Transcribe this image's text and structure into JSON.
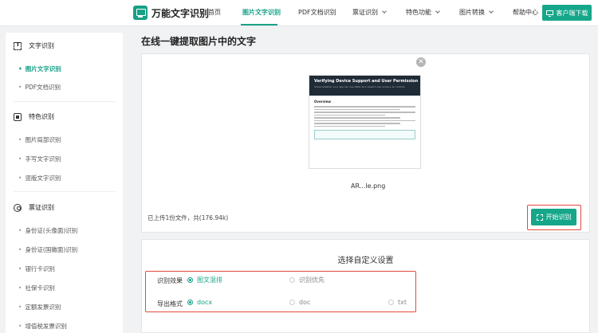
{
  "header": {
    "logo_text": "万能文字识别",
    "nav": [
      {
        "label": "首页"
      },
      {
        "label": "图片文字识别",
        "active": true
      },
      {
        "label": "PDF文档识别"
      },
      {
        "label": "票证识别",
        "dropdown": true
      },
      {
        "label": "特色功能",
        "dropdown": true
      },
      {
        "label": "图片转换",
        "dropdown": true
      },
      {
        "label": "帮助中心"
      }
    ],
    "client_button": "客户端下载"
  },
  "sidebar": {
    "groups": [
      {
        "title": "文字识别",
        "icon": "text-scan-icon",
        "items": [
          {
            "label": "图片文字识别",
            "active": true
          },
          {
            "label": "PDF文档识别"
          }
        ]
      },
      {
        "title": "特色识别",
        "icon": "feature-icon",
        "items": [
          {
            "label": "图片局部识别"
          },
          {
            "label": "手写文字识别"
          },
          {
            "label": "竖版文字识别"
          }
        ]
      },
      {
        "title": "票证识别",
        "icon": "ticket-icon",
        "items": [
          {
            "label": "身份证(头像面)识别"
          },
          {
            "label": "身份证(国徽面)识别"
          },
          {
            "label": "银行卡识别"
          },
          {
            "label": "社保卡识别"
          },
          {
            "label": "定额发票识别"
          },
          {
            "label": "增值税发票识别"
          }
        ]
      }
    ]
  },
  "main": {
    "title": "在线一键提取图片中的文字",
    "upload": {
      "close_symbol": "✕",
      "file_name": "AR...le.png",
      "info": "已上传1份文件，共(176.94k)",
      "start_button": "开始识别",
      "preview": {
        "title": "Verifying Device Support and User Permission",
        "subtitle": "Check whether your app can use ARKit and respect user privacy at runtime.",
        "heading": "Overview"
      }
    },
    "settings": {
      "title": "选择自定义设置",
      "rows": [
        {
          "label": "识别效果",
          "options": [
            {
              "label": "图文混排",
              "selected": true
            },
            {
              "label": "识别优先",
              "selected": false
            }
          ]
        },
        {
          "label": "导出格式",
          "options": [
            {
              "label": "docx",
              "selected": true
            },
            {
              "label": "doc",
              "selected": false
            },
            {
              "label": "txt",
              "selected": false
            }
          ]
        }
      ]
    }
  },
  "colors": {
    "accent": "#17a388",
    "highlight": "#e34a3c"
  }
}
